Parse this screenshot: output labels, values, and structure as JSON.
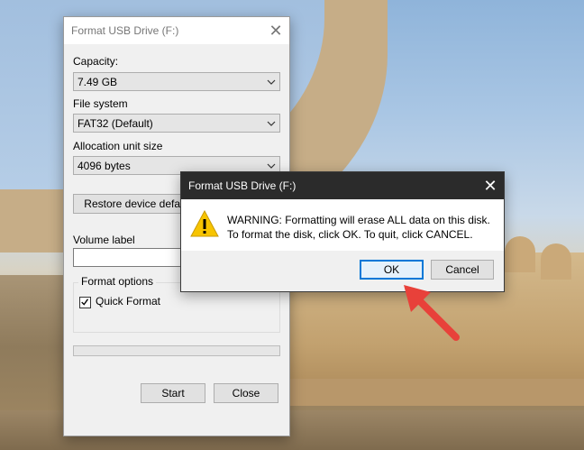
{
  "format_window": {
    "title": "Format USB Drive (F:)",
    "capacity_label": "Capacity:",
    "capacity_value": "7.49 GB",
    "filesystem_label": "File system",
    "filesystem_value": "FAT32 (Default)",
    "allocation_label": "Allocation unit size",
    "allocation_value": "4096 bytes",
    "restore_button": "Restore device defaults",
    "volume_label": "Volume label",
    "volume_value": "",
    "format_options_label": "Format options",
    "quick_format_label": "Quick Format",
    "quick_format_checked": true,
    "start_button": "Start",
    "close_button": "Close"
  },
  "warning_dialog": {
    "title": "Format USB Drive (F:)",
    "message_line1": "WARNING: Formatting will erase ALL data on this disk.",
    "message_line2": "To format the disk, click OK. To quit, click CANCEL.",
    "ok_button": "OK",
    "cancel_button": "Cancel",
    "icon": "warning-icon"
  },
  "annotation": {
    "arrow_color": "#e8413a",
    "points_to": "ok-button"
  },
  "colors": {
    "accent": "#0078d7",
    "dark_titlebar": "#2b2b2b",
    "warning_yellow": "#f7c400"
  }
}
